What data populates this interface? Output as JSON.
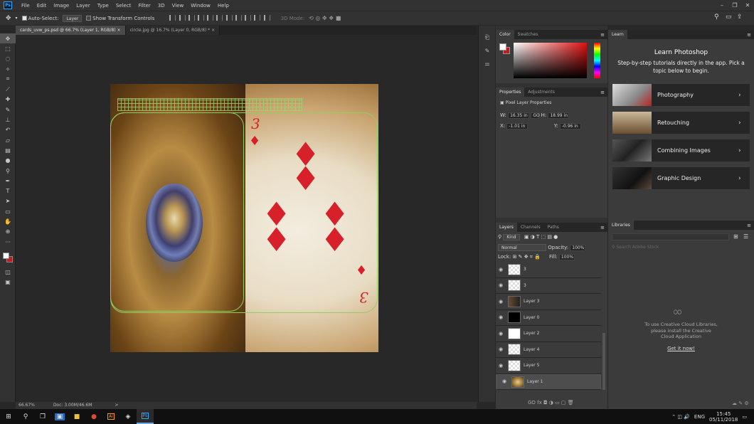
{
  "app": {
    "logo": "Ps"
  },
  "menu": [
    "File",
    "Edit",
    "Image",
    "Layer",
    "Type",
    "Select",
    "Filter",
    "3D",
    "View",
    "Window",
    "Help"
  ],
  "options": {
    "auto_select_label": "Auto-Select:",
    "auto_select_value": "Layer",
    "transform_label": "Show Transform Controls",
    "mode_3d": "3D Mode:"
  },
  "tabs": [
    {
      "label": "cards_uvw_ps.psd @ 66.7% (Layer 1, RGB/8)",
      "close": "×"
    },
    {
      "label": "circle.jpg @ 16.7% (Layer 0, RGB/8) *",
      "close": "×"
    }
  ],
  "status": {
    "zoom": "66.67%",
    "doc": "Doc: 3.00M/46.6M",
    "arrow": ">"
  },
  "card": {
    "rank": "3"
  },
  "color_panel": {
    "tabs": [
      "Color",
      "Swatches"
    ],
    "fg": "#ffffff",
    "bg": "#c21b1b"
  },
  "properties": {
    "tabs": [
      "Properties",
      "Adjustments"
    ],
    "heading": "Pixel Layer Properties",
    "w_label": "W:",
    "w": "16.35 in",
    "h_label": "H:",
    "h": "18.99 in",
    "x_label": "X:",
    "x": "-1.01 in",
    "y_label": "Y:",
    "y": "-0.96 in",
    "link": "GO"
  },
  "layers_panel": {
    "tabs": [
      "Layers",
      "Channels",
      "Paths"
    ],
    "kind": "Kind",
    "blend": "Normal",
    "opacity_label": "Opacity:",
    "opacity": "100%",
    "lock_label": "Lock:",
    "fill_label": "Fill:",
    "fill": "100%",
    "layers": [
      {
        "name": "3",
        "thumb": "checker"
      },
      {
        "name": "3",
        "thumb": "checker"
      },
      {
        "name": "Layer 3",
        "thumb": "dark"
      },
      {
        "name": "Layer 0",
        "thumb": "black"
      },
      {
        "name": "Layer 2",
        "thumb": "white"
      },
      {
        "name": "Layer 4",
        "thumb": "checker"
      },
      {
        "name": "Layer 5",
        "thumb": "checker"
      },
      {
        "name": "Layer 1",
        "thumb": "photo"
      }
    ],
    "footer": "GO  fx  ◘  ◑  ▭  ▢  🗑"
  },
  "learn": {
    "tab": "Learn",
    "title": "Learn Photoshop",
    "subtitle": "Step-by-step tutorials directly in the app. Pick a topic below to begin.",
    "cards": [
      "Photography",
      "Retouching",
      "Combining Images",
      "Graphic Design"
    ]
  },
  "libraries": {
    "tab": "Libraries",
    "search_placeholder": "Search Adobe Stock",
    "message": "To use Creative Cloud Libraries, please install the Creative Cloud Application",
    "link": "Get it now!"
  },
  "taskbar": {
    "lang": "ENG",
    "time": "15:45",
    "date": "05/11/2018"
  }
}
